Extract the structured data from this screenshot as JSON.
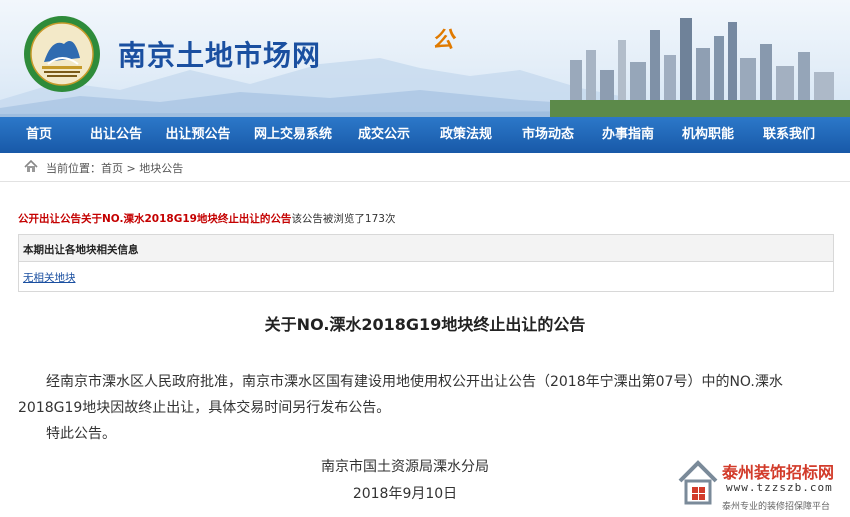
{
  "header": {
    "site_title": "南京土地市场网",
    "deco_text": "公"
  },
  "nav": {
    "items": [
      {
        "label": "首页"
      },
      {
        "label": "出让公告"
      },
      {
        "label": "出让预公告"
      },
      {
        "label": "网上交易系统"
      },
      {
        "label": "成交公示"
      },
      {
        "label": "政策法规"
      },
      {
        "label": "市场动态"
      },
      {
        "label": "办事指南"
      },
      {
        "label": "机构职能"
      },
      {
        "label": "联系我们"
      }
    ]
  },
  "breadcrumb": {
    "prefix": "当前位置：",
    "home": "首页",
    "sep": " > ",
    "current": "地块公告"
  },
  "notice": {
    "title_link": "公开出让公告关于NO.溧水2018G19地块终止出让的公告",
    "views_text": "该公告被浏览了173次"
  },
  "related": {
    "header": "本期出让各地块相关信息",
    "link": "无相关地块"
  },
  "article": {
    "title": "关于NO.溧水2018G19地块终止出让的公告",
    "body": "经南京市溧水区人民政府批准，南京市溧水区国有建设用地使用权公开出让公告（2018年宁溧出第07号）中的NO.溧水2018G19地块因故终止出让，具体交易时间另行发布公告。",
    "closing": "特此公告。",
    "signature": "南京市国土资源局溧水分局",
    "date": "2018年9月10日"
  },
  "watermark": {
    "title": "泰州装饰招标网",
    "url": "www.tzzszb.com",
    "slogan": "泰州专业的装修招保障平台"
  },
  "colors": {
    "nav_bg": "#1d62b0",
    "title_blue": "#1a4fa0",
    "notice_red": "#c40000"
  }
}
